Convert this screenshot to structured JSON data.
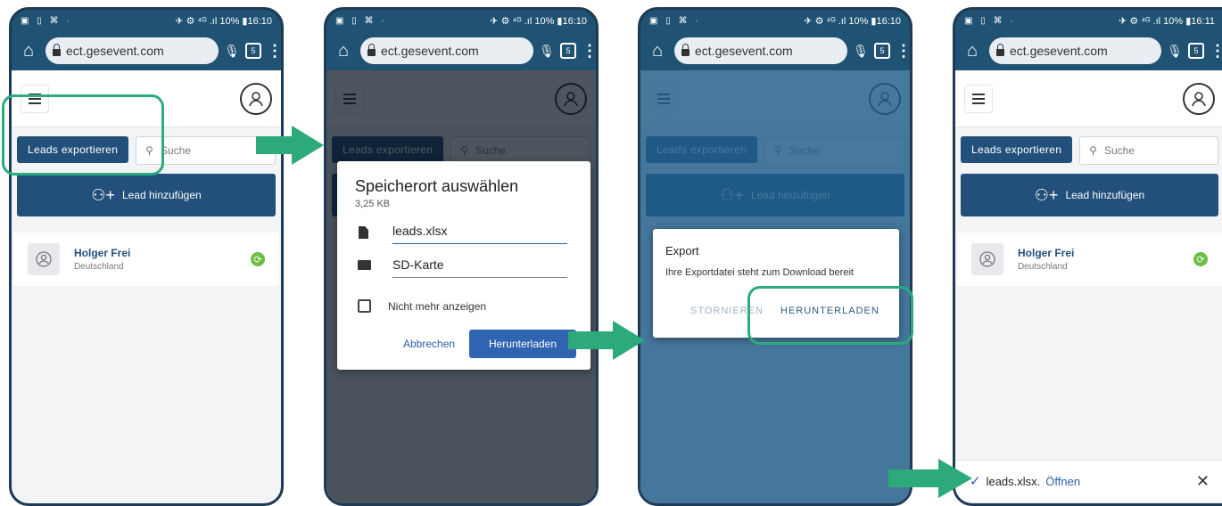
{
  "status": {
    "left": "▣ ▯ ⌘ ·",
    "right": "✈ ⚙ ⁴ᴳ .ıl 10% ▮16:10",
    "right_last": "✈ ⚙ ⁴ᴳ .ıl 10% ▮16:11"
  },
  "browser": {
    "url": "ect.gesevent.com",
    "tabs": "5"
  },
  "app": {
    "export_label": "Leads exportieren",
    "search_placeholder": "Suche",
    "add_label": "Lead hinzufügen",
    "lead": {
      "name": "Holger Frei",
      "country": "Deutschland"
    }
  },
  "save_dialog": {
    "title": "Speicherort auswählen",
    "size": "3,25 KB",
    "filename": "leads.xlsx",
    "location": "SD-Karte",
    "checkbox": "Nicht mehr anzeigen",
    "cancel": "Abbrechen",
    "download": "Herunterladen"
  },
  "export_dialog": {
    "title": "Export",
    "message": "Ihre Exportdatei steht zum Download bereit",
    "cancel": "STORNIEREN",
    "download": "HERUNTERLADEN"
  },
  "snackbar": {
    "file": "leads.xlsx.",
    "open": "Öffnen"
  },
  "colors": {
    "brand": "#22507a",
    "highlight": "#2dab7f",
    "arrow": "#2daa7b",
    "sync": "#6cbf43"
  }
}
